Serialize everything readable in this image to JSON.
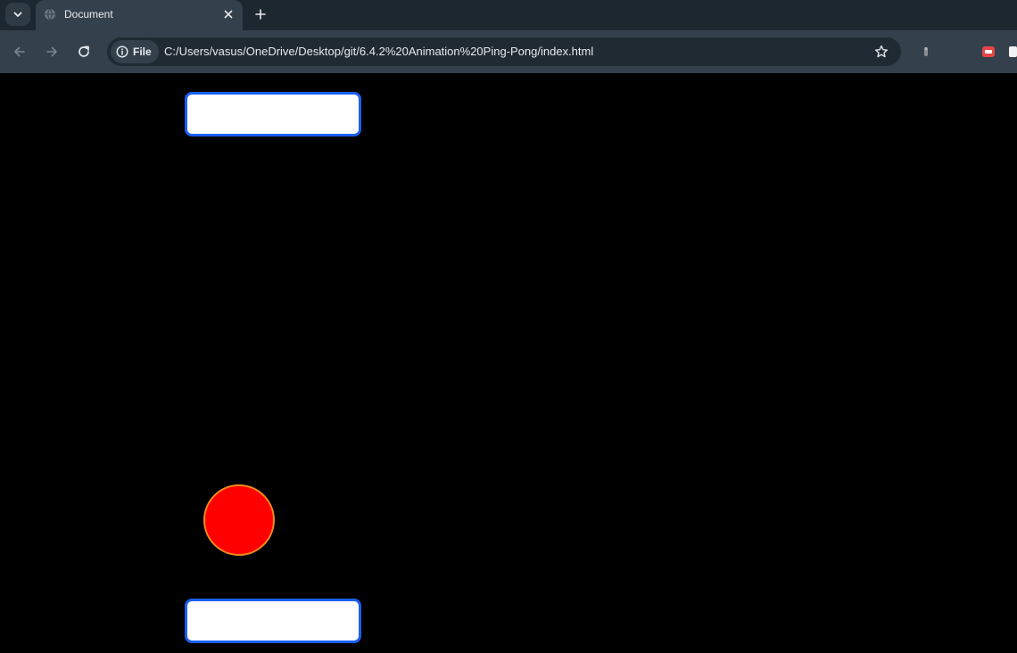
{
  "browser": {
    "tab": {
      "title": "Document"
    },
    "omnibox": {
      "site_chip_label": "File",
      "url": "C:/Users/vasus/OneDrive/Desktop/git/6.4.2%20Animation%20Ping-Pong/index.html"
    },
    "icons": {
      "tab_search": "chevron-down-icon",
      "favicon": "globe-icon",
      "tab_close": "close-icon",
      "new_tab": "plus-icon",
      "back": "arrow-left-icon",
      "forward": "arrow-right-icon",
      "reload": "reload-icon",
      "site_info": "info-icon",
      "bookmark": "star-icon"
    }
  },
  "page": {
    "background_color": "#000000",
    "paddle_fill": "#ffffff",
    "paddle_border": "#1a5ff2",
    "ball_fill": "#ff0000",
    "ball_border": "#f08a1c"
  }
}
